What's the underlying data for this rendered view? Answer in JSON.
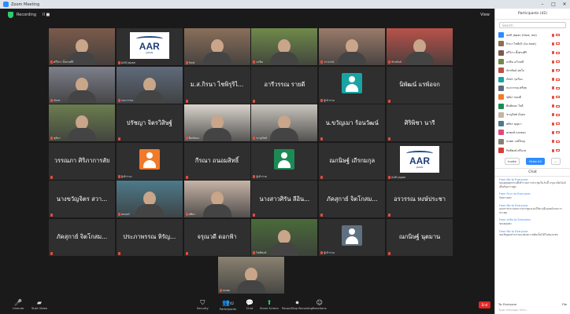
{
  "window": {
    "title": "Zoom Meeting",
    "controls": [
      "–",
      "□",
      "✕"
    ]
  },
  "topbar": {
    "recording_label": "Recording",
    "pause_label": "II ■",
    "view_label": "View"
  },
  "tiles": [
    {
      "kind": "photo",
      "label": "ศรีวิภา ตั้งตรงศิริ",
      "bg": "#7b5a4a"
    },
    {
      "kind": "logo",
      "label": "AAR Japan"
    },
    {
      "kind": "photo",
      "label": "Host",
      "bg": "#8a6f59",
      "active": true
    },
    {
      "kind": "photo",
      "label": "อรพิน",
      "bg": "#6f8a4a"
    },
    {
      "kind": "photo",
      "label": "วราภรณ์",
      "bg": "#9a7a6a"
    },
    {
      "kind": "photo",
      "label": "จักรพันธ์",
      "bg": "#b8524a"
    },
    {
      "kind": "photo",
      "label": "ภัสสร",
      "bg": "#7d7f8a"
    },
    {
      "kind": "photo",
      "label": "กนกวรรณ",
      "bg": "#5f6a7a"
    },
    {
      "kind": "name",
      "label": "ม.ส.กิรนา ไชพิรุริไ..."
    },
    {
      "kind": "name",
      "label": "อารีวรรณ รายดี"
    },
    {
      "kind": "avatar",
      "label": "ผู้เข้าร่วม",
      "color": "#1aa3a3"
    },
    {
      "kind": "name",
      "label": "นิพัฒน์ แรพ้อจก"
    },
    {
      "kind": "photo",
      "label": "ชุติมา",
      "bg": "#6b7d4f"
    },
    {
      "kind": "name",
      "label": "ปรัชญา จิตรวิสิษฐ์"
    },
    {
      "kind": "photo",
      "label": "พิมพ์ชนก",
      "bg": "#d9d4cc"
    },
    {
      "kind": "photo",
      "label": "ชาญวิทย์",
      "bg": "#c9c5bd"
    },
    {
      "kind": "name",
      "label": "น.ขวัญเมา ร้อนวัฒน์"
    },
    {
      "kind": "name",
      "label": "ศิริพิชา นารี"
    },
    {
      "kind": "name",
      "label": "วรรณภา ศิริภาการสัย"
    },
    {
      "kind": "avatar",
      "label": "ผู้เข้าร่วม",
      "color": "#f07a2a"
    },
    {
      "kind": "name",
      "label": "กีรณา ถนอมสิทธิ์"
    },
    {
      "kind": "avatar",
      "label": "ผู้เข้าร่วม",
      "color": "#1d8a55"
    },
    {
      "kind": "name",
      "label": "ณกนิษฐ์ เถีรกมกุล"
    },
    {
      "kind": "logo",
      "label": "AAR Japan"
    },
    {
      "kind": "name",
      "label": "นางขวัญจิตร สวา..."
    },
    {
      "kind": "photo",
      "label": "สมพงษ์",
      "bg": "#4d7a8a"
    },
    {
      "kind": "photo",
      "label": "ศศิธร",
      "bg": "#c7b3a6"
    },
    {
      "kind": "name",
      "label": "นางสาวศิรัน ลีอิน..."
    },
    {
      "kind": "name",
      "label": "ภัคสุกาย์ จิตโกสม..."
    },
    {
      "kind": "name",
      "label": "อรวรรณ หงษ์ประชา"
    },
    {
      "kind": "name",
      "label": "ภัคสุกาย์ จิตโกสม..."
    },
    {
      "kind": "name",
      "label": "ประภาพรรณ หิรัญ..."
    },
    {
      "kind": "name",
      "label": "จรุณวดี ดอกฟ้า"
    },
    {
      "kind": "photo",
      "label": "กิตติพงษ์",
      "bg": "#4a6b3a"
    },
    {
      "kind": "avatar",
      "label": "ผู้เข้าร่วม",
      "color": "#5f7080"
    },
    {
      "kind": "name",
      "label": "ณกนิษฐ์ นุตมาน"
    },
    {
      "kind": "photo",
      "label": "ธนพล",
      "bg": "#8a8270"
    }
  ],
  "toolbar": {
    "mute": {
      "icon": "🎤",
      "label": "Unmute"
    },
    "video": {
      "icon": "▰",
      "label": "Start Video"
    },
    "security": {
      "icon": "⛉",
      "label": "Security"
    },
    "participants": {
      "icon": "👥",
      "label": "Participants",
      "count": "42"
    },
    "chat": {
      "icon": "💬",
      "label": "Chat"
    },
    "share": {
      "icon": "⬆",
      "label": "Share Screen"
    },
    "record": {
      "icon": "⏺",
      "label": "Pause/Stop Recording"
    },
    "reactions": {
      "icon": "☺",
      "label": "Reactions"
    },
    "end": "End"
  },
  "panel": {
    "participants_title": "Participants (42)",
    "search_placeholder": "Search",
    "participants": [
      {
        "name": "AAR Japan (Host, me)",
        "color": "#2d8cff"
      },
      {
        "name": "กิรนา ไชพิรุริ (Co-host)",
        "color": "#8a6f59"
      },
      {
        "name": "ศรีวิภา ตั้งตรงศิริ",
        "color": "#7b5a4a"
      },
      {
        "name": "อรพิน แก้วมณี",
        "color": "#6f8a4a"
      },
      {
        "name": "จักรพันธ์ สุขใจ",
        "color": "#b8524a"
      },
      {
        "name": "ภัสสร รุ่งเรือง",
        "color": "#1aa3a3"
      },
      {
        "name": "กนกวรรณ ศรีสุข",
        "color": "#5f6a7a"
      },
      {
        "name": "ชุติมา ทองดี",
        "color": "#f07a2a"
      },
      {
        "name": "พิมพ์ชนก ใจดี",
        "color": "#1d8a55"
      },
      {
        "name": "ชาญวิทย์ มั่นคง",
        "color": "#c7b3a6"
      },
      {
        "name": "ศศิธร บุญมา",
        "color": "#4d7a8a"
      },
      {
        "name": "สมพงษ์ แสงทอง",
        "color": "#e04a7a"
      },
      {
        "name": "ธนพล วงศ์ใหญ่",
        "color": "#8a8270"
      },
      {
        "name": "กิตติพงษ์ ศรีนวล",
        "color": "#d43c3c"
      }
    ],
    "invite": "Invite",
    "mute_all": "Mute All",
    "more": "...",
    "chat_title": "Chat",
    "messages": [
      {
        "from": "From Me to Everyone:",
        "text": "ขอบคุณทุกท่านที่เข้าร่วมการประชุมในวันนี้ กรุณาเปิดไมค์เมื่อต้องการพูด"
      },
      {
        "from": "From กิรนา to Everyone:",
        "text": "รับทราบค่ะ"
      },
      {
        "from": "From Me to Everyone:",
        "text": "เอกสารประกอบการประชุมจะส่งให้ทางอีเมลหลังจบการประชุม"
      },
      {
        "from": "From อรพิน to Everyone:",
        "text": "ขอบคุณค่ะ"
      },
      {
        "from": "From Me to Everyone:",
        "text": "ขอเชิญทุกท่านร่วมแสดงความคิดเห็นได้ในช่องแชท"
      }
    ],
    "to_label": "To: Everyone",
    "file_label": "File",
    "placeholder": "Type message here..."
  }
}
